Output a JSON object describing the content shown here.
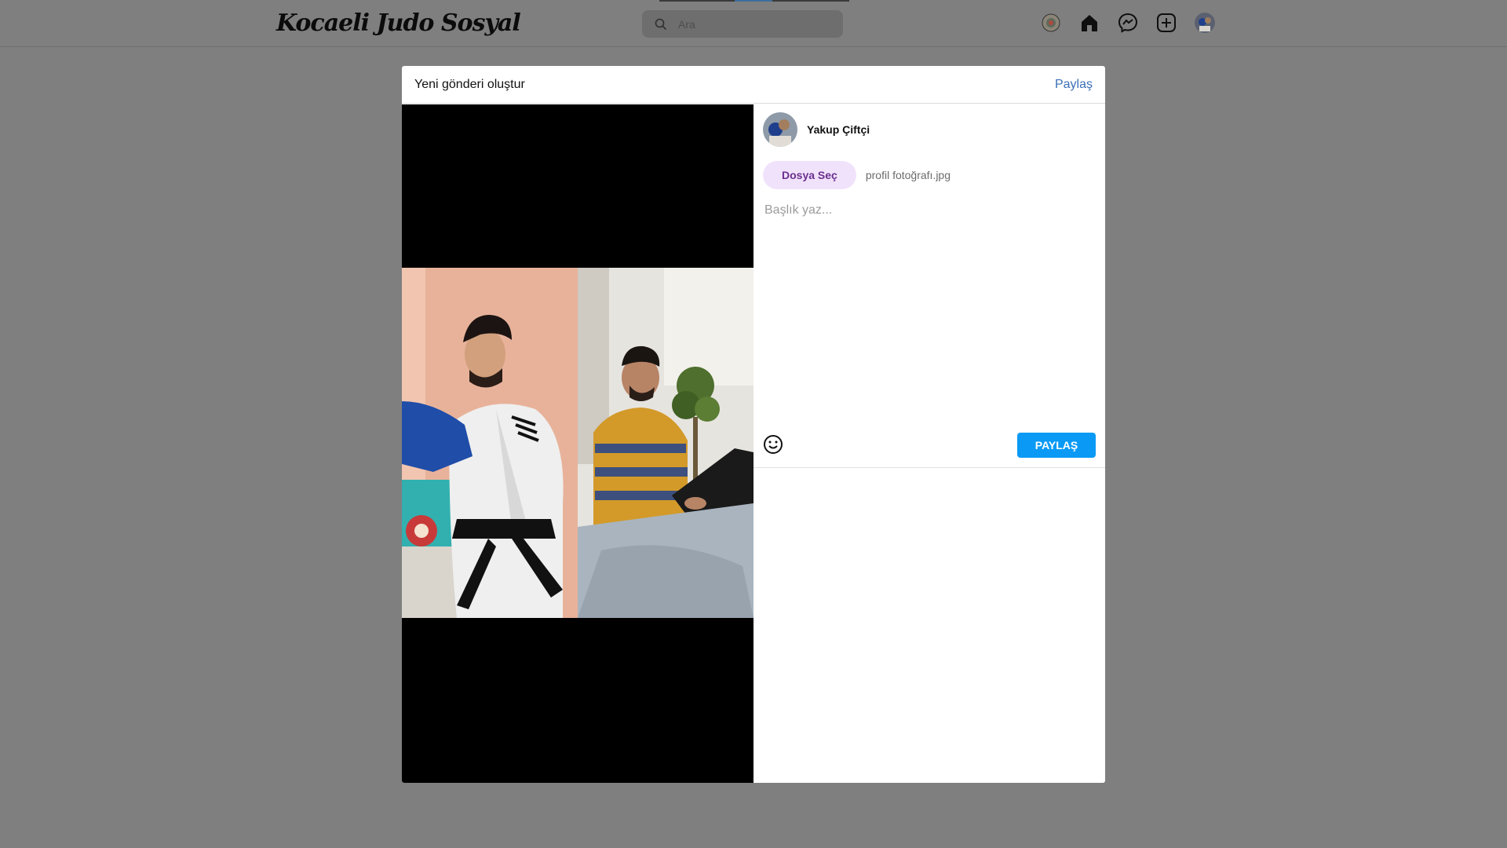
{
  "nav": {
    "logo": "Kocaeli Judo Sosyal",
    "search_placeholder": "Ara",
    "icons": [
      "federation-logo-icon",
      "home-icon",
      "messenger-icon",
      "create-post-icon",
      "profile-avatar-icon"
    ]
  },
  "modal": {
    "title": "Yeni gönderi oluştur",
    "header_share": "Paylaş",
    "author_name": "Yakup Çiftçi",
    "file_button": "Dosya Seç",
    "file_name": "profil fotoğrafı.jpg",
    "caption_placeholder": "Başlık yaz...",
    "share_button": "PAYLAŞ",
    "images": [
      "judo-athlete-photo",
      "laptop-working-photo"
    ]
  },
  "colors": {
    "overlay": "#7f7f7f",
    "accent": "#0a9af5",
    "link": "#3b6fb6",
    "file_button_bg": "#f1e2fb",
    "file_button_text": "#6b2f8f"
  }
}
